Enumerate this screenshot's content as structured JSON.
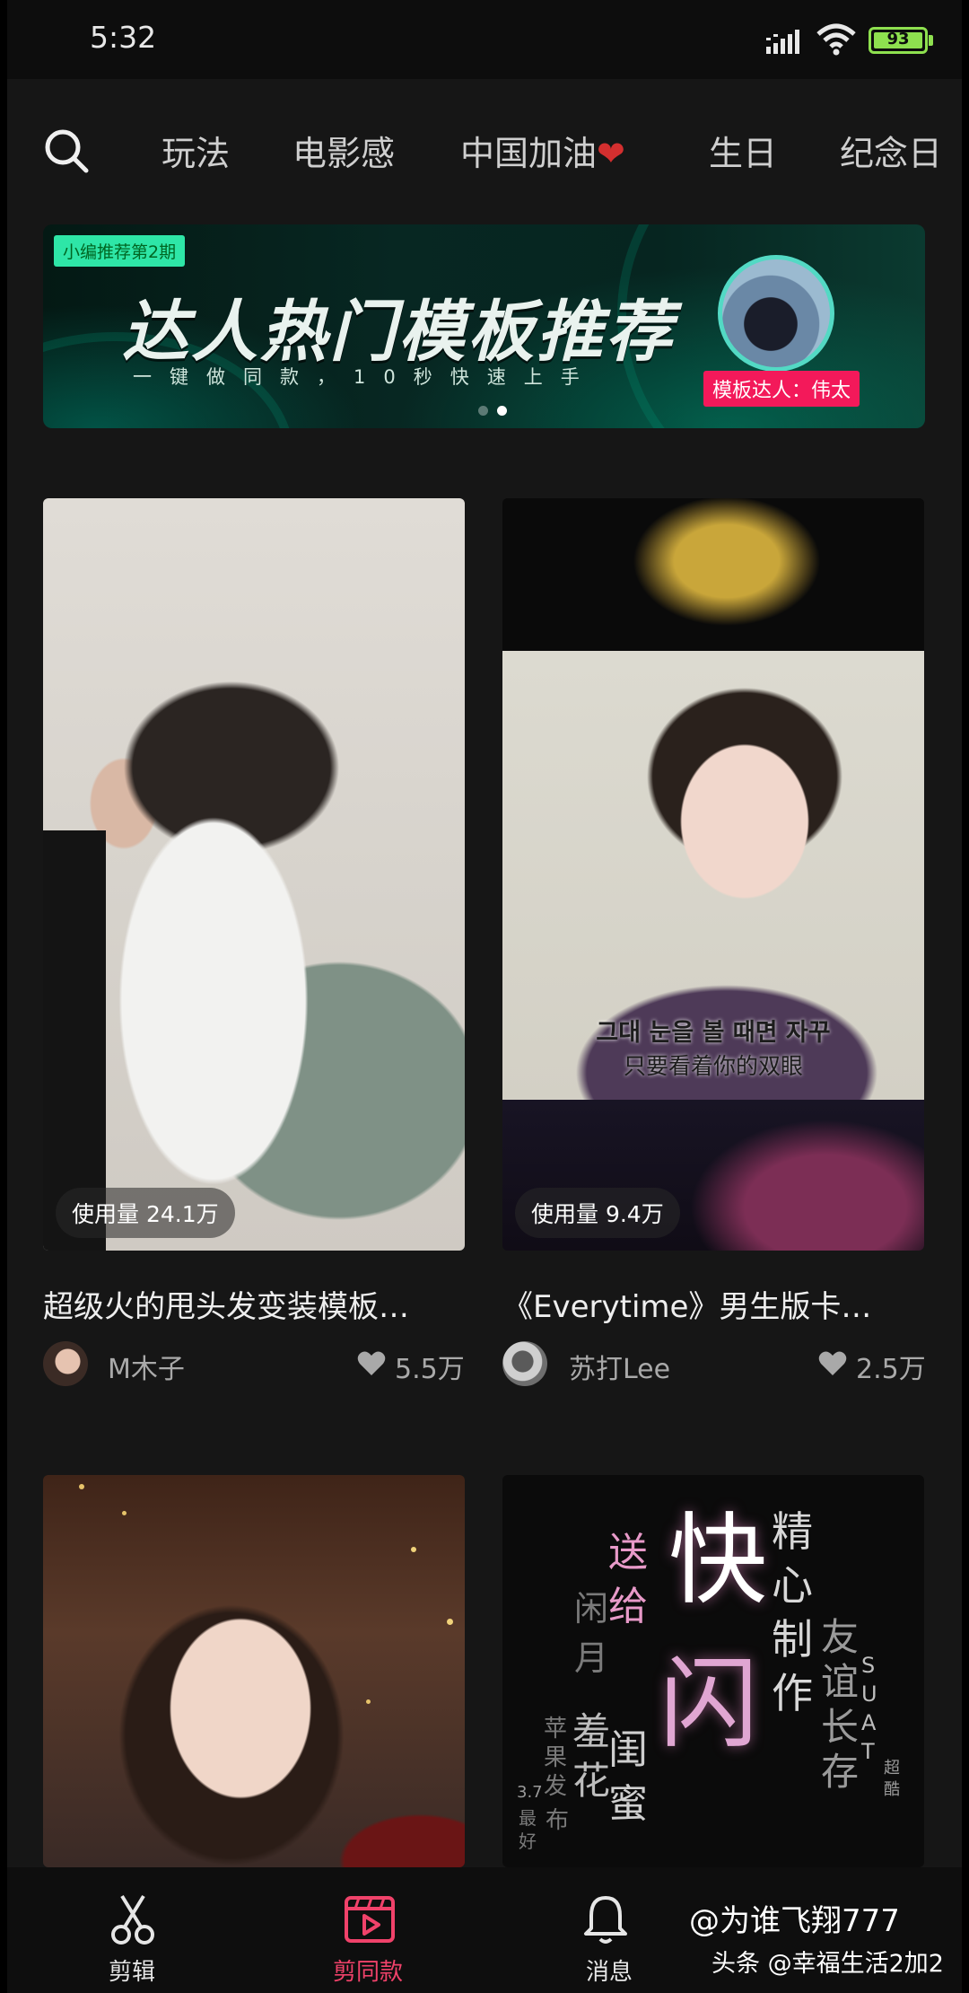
{
  "status_bar": {
    "time": "5:32",
    "battery": "93"
  },
  "tabs": [
    "玩法",
    "电影感",
    "中国加油",
    "生日",
    "纪念日"
  ],
  "tab_heart": "❤",
  "banner": {
    "tag": "小编推荐第2期",
    "title": "达人热门模板推荐",
    "subtitle": "一键做同款，10秒快速上手",
    "expert": "模板达人：伟太",
    "page_count": 2,
    "active_page": 2
  },
  "cards": [
    {
      "usage": "使用量 24.1万",
      "title": "超级火的甩头发变装模板…",
      "author": "M木子",
      "likes": "5.5万"
    },
    {
      "usage": "使用量 9.4万",
      "title": "《Everytime》男生版卡…",
      "author": "苏打Lee",
      "likes": "2.5万",
      "caption_korean": "그대 눈을 볼 때면 자꾸",
      "caption_chinese": "只要看着你的双眼"
    },
    {},
    {
      "poster_words": [
        "送",
        "快",
        "精",
        "给",
        "心",
        "闲",
        "友",
        "月",
        "制",
        "谊",
        "苹",
        "羞",
        "作",
        "长",
        "果",
        "闪",
        "闺",
        "存",
        "花",
        "发",
        "蜜",
        "3.7",
        "最",
        "好",
        "布",
        "S",
        "U",
        "A",
        "T",
        "超",
        "酷"
      ]
    }
  ],
  "bottom_nav": [
    {
      "label": "剪辑",
      "icon": "scissors-icon"
    },
    {
      "label": "剪同款",
      "icon": "template-video-icon"
    },
    {
      "label": "消息",
      "icon": "bell-icon"
    }
  ],
  "colors": {
    "active_nav": "#f0426a",
    "banner_pink": "#f3195a",
    "banner_green": "#2ee6a7"
  },
  "watermark": {
    "line1": "@为谁飞翔777",
    "line2": "头条 @幸福生活2加2"
  }
}
